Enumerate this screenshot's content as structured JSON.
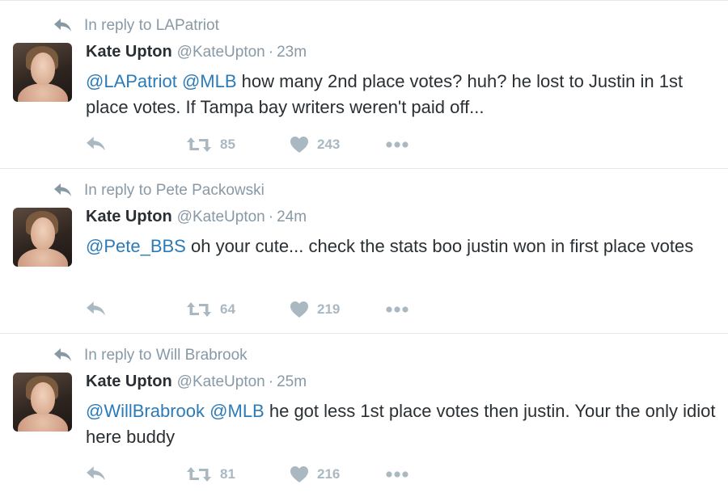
{
  "tweets": [
    {
      "reply_context": "In reply to LAPatriot",
      "author_name": "Kate Upton",
      "author_handle": "@KateUpton",
      "separator": "·",
      "time": "23m",
      "mentions": [
        "@LAPatriot",
        "@MLB"
      ],
      "text": "how many 2nd place votes? huh? he lost to Justin in 1st place votes. If Tampa bay writers weren't paid off...",
      "retweets": "85",
      "likes": "243"
    },
    {
      "reply_context": "In reply to Pete Packowski",
      "author_name": "Kate Upton",
      "author_handle": "@KateUpton",
      "separator": "·",
      "time": "24m",
      "mentions": [
        "@Pete_BBS"
      ],
      "text": "oh your cute... check the stats boo justin won in first place votes",
      "retweets": "64",
      "likes": "219"
    },
    {
      "reply_context": "In reply to Will Brabrook",
      "author_name": "Kate Upton",
      "author_handle": "@KateUpton",
      "separator": "·",
      "time": "25m",
      "mentions": [
        "@WillBrabrook",
        "@MLB"
      ],
      "text": "he got less 1st place votes then justin. Your the only idiot here buddy",
      "retweets": "81",
      "likes": "216"
    }
  ],
  "icons": {
    "reply": "reply-arrow-icon",
    "retweet": "retweet-icon",
    "like": "heart-icon",
    "more": "more-dots-icon"
  },
  "colors": {
    "mention": "#2b7bb9",
    "muted": "#8899a6",
    "action": "#aab8c2",
    "text": "#292f33",
    "divider": "#e1e8ed"
  }
}
